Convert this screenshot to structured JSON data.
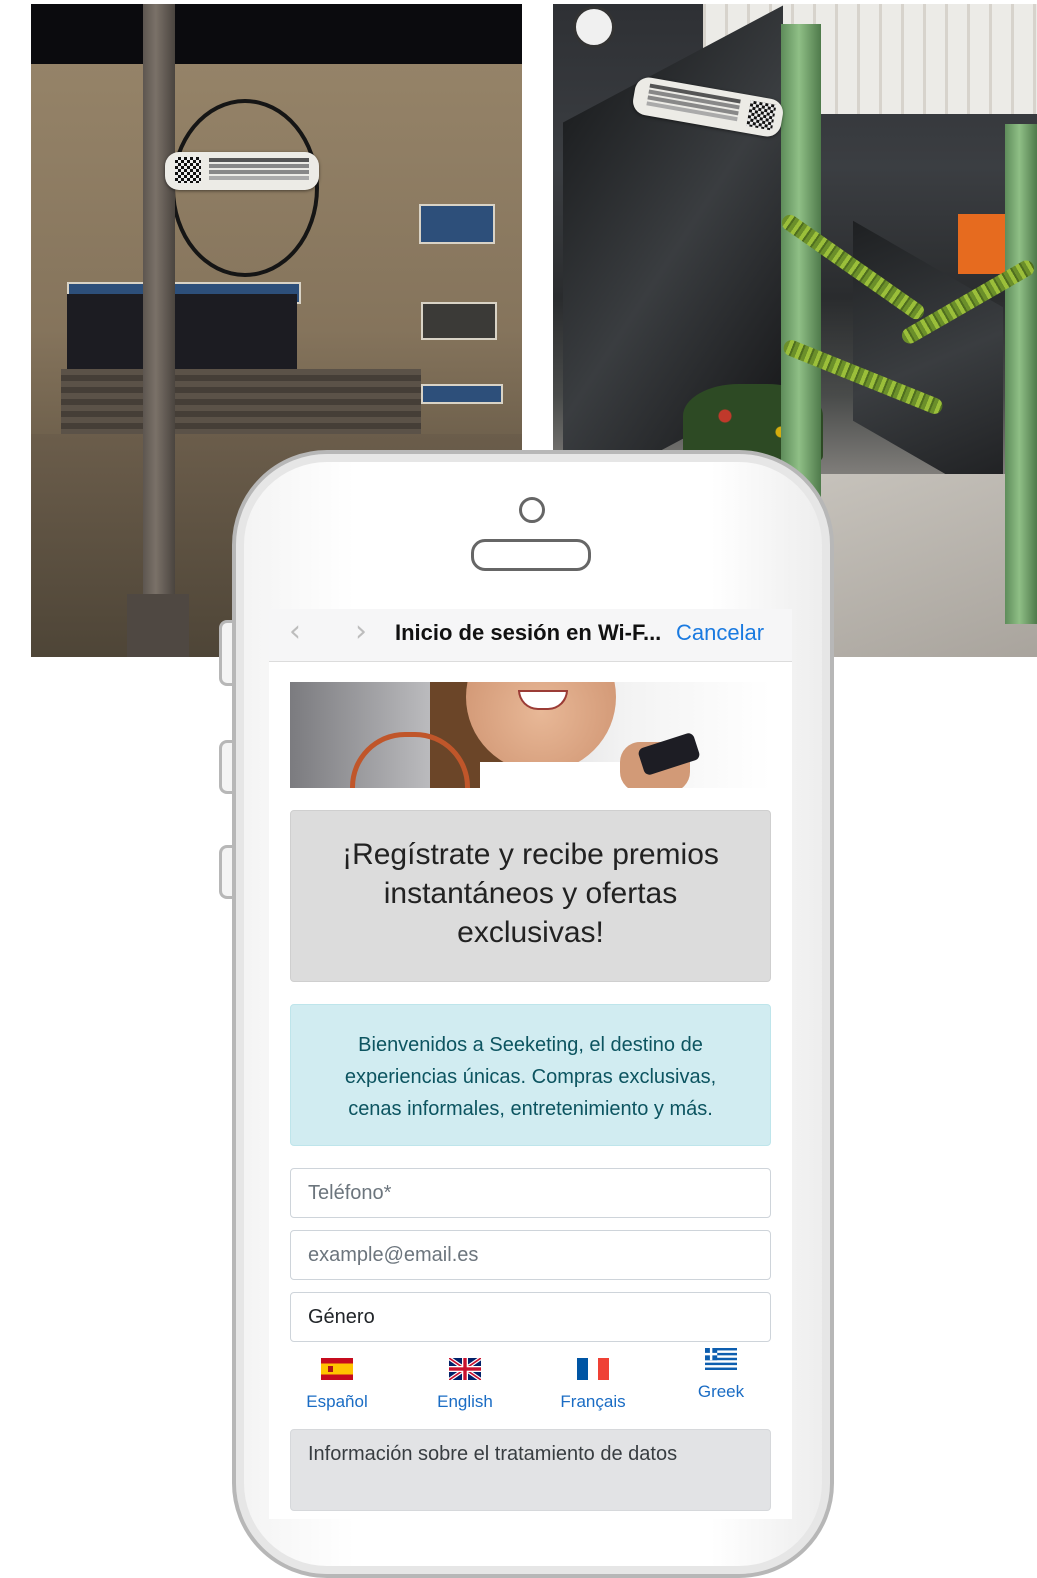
{
  "browser": {
    "back_icon": "chevron-left-icon",
    "forward_icon": "chevron-right-icon",
    "title": "Inicio de sesión en Wi-F...",
    "cancel_label": "Cancelar"
  },
  "promo": {
    "headline_lines": [
      "¡Regístrate y recibe premios",
      "instantáneos y ofertas",
      "exclusivas!"
    ]
  },
  "welcome": {
    "lines": [
      "Bienvenidos a Seeketing, el destino de",
      "experiencias únicas. Compras exclusivas,",
      "cenas informales, entretenimiento y más."
    ]
  },
  "form": {
    "phone_placeholder": "Teléfono*",
    "email_placeholder": "example@email.es",
    "gender_value": "Género"
  },
  "languages": [
    {
      "label": "Español",
      "icon": "spain-flag-icon"
    },
    {
      "label": "English",
      "icon": "uk-flag-icon"
    },
    {
      "label": "Français",
      "icon": "france-flag-icon"
    },
    {
      "label": "Greek",
      "icon": "greece-flag-icon"
    }
  ],
  "legal": {
    "title": "Información sobre el tratamiento de datos"
  },
  "colors": {
    "link_blue": "#1a7ae0",
    "info_bg": "#d1ecf1",
    "info_text": "#0c5460",
    "promo_bg": "#dcdcdc",
    "legal_bg": "#e2e3e5"
  }
}
